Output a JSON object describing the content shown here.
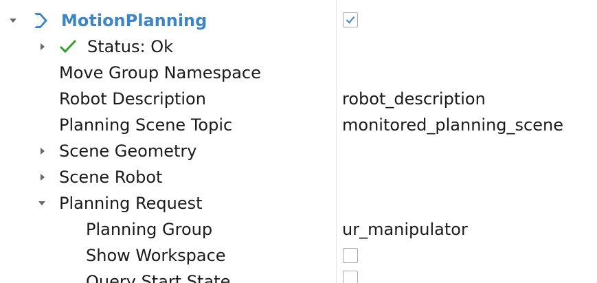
{
  "colors": {
    "accent": "#3d85c6",
    "status_ok": "#2ea02e",
    "expander": "#666666"
  },
  "display": {
    "title": "MotionPlanning",
    "enabled": true,
    "icon": "motion-planning-icon"
  },
  "properties": {
    "status": {
      "label": "Status: Ok",
      "icon": "check-icon"
    },
    "move_group_namespace": {
      "label": "Move Group Namespace",
      "value": ""
    },
    "robot_description": {
      "label": "Robot Description",
      "value": "robot_description"
    },
    "planning_scene_topic": {
      "label": "Planning Scene Topic",
      "value": "monitored_planning_scene"
    },
    "scene_geometry": {
      "label": "Scene Geometry"
    },
    "scene_robot": {
      "label": "Scene Robot"
    },
    "planning_request": {
      "label": "Planning Request",
      "planning_group": {
        "label": "Planning Group",
        "value": "ur_manipulator"
      },
      "show_workspace": {
        "label": "Show Workspace",
        "checked": false
      },
      "query_start_state": {
        "label": "Query Start State",
        "checked": false
      }
    }
  }
}
